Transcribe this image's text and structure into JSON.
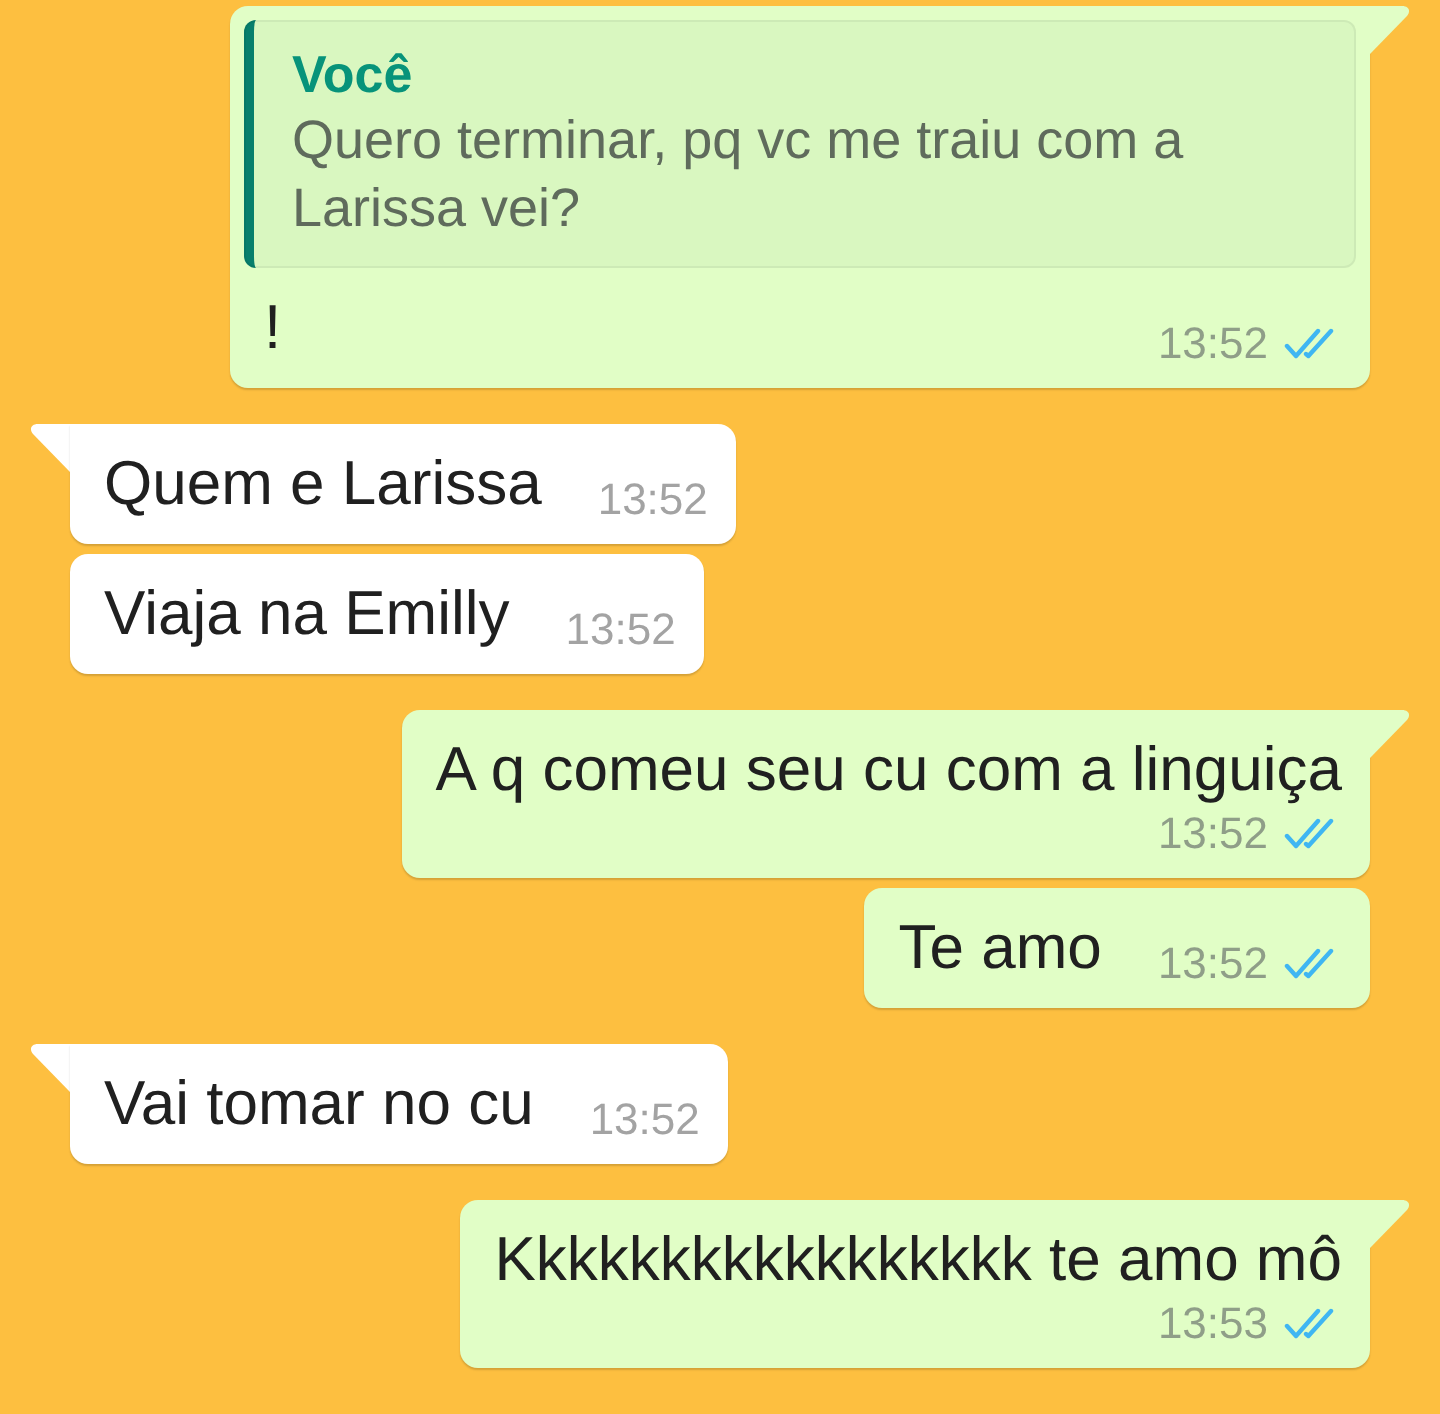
{
  "messages": [
    {
      "kind": "outgoing",
      "tail": true,
      "quote": {
        "author": "Você",
        "text": "Quero terminar, pq vc me traiu com a Larissa vei?"
      },
      "text": "!",
      "time": "13:52",
      "read": true
    },
    {
      "kind": "incoming",
      "tail": true,
      "text": "Quem e Larissa",
      "time": "13:52"
    },
    {
      "kind": "incoming",
      "tail": false,
      "text": "Viaja na Emilly",
      "time": "13:52"
    },
    {
      "kind": "outgoing",
      "tail": true,
      "text": "A q comeu seu cu com a linguiça",
      "time": "13:52",
      "read": true
    },
    {
      "kind": "outgoing",
      "tail": false,
      "text": "Te amo",
      "time": "13:52",
      "read": true
    },
    {
      "kind": "incoming",
      "tail": true,
      "text": "Vai tomar no cu",
      "time": "13:52"
    },
    {
      "kind": "outgoing",
      "tail": true,
      "text": "Kkkkkkkkkkkkkkkkk te amo mô",
      "time": "13:53",
      "read": true
    }
  ]
}
